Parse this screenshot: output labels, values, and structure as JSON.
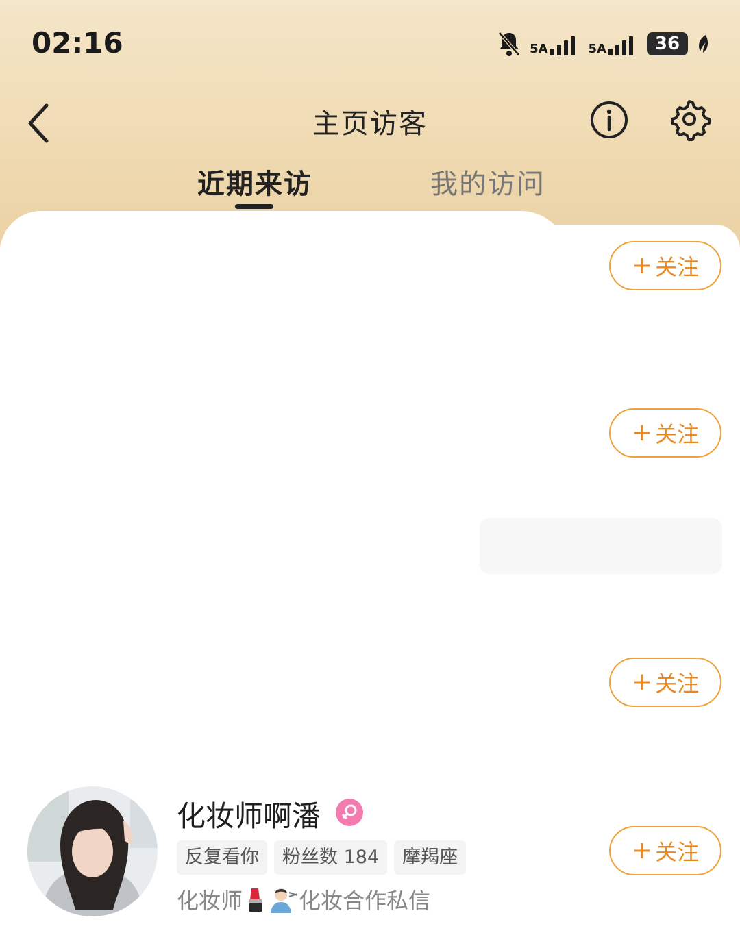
{
  "status_bar": {
    "time": "02:16",
    "signal1_label": "5A",
    "signal2_label": "5A",
    "battery": "36"
  },
  "nav": {
    "title": "主页访客"
  },
  "tabs": [
    {
      "label": "近期来访",
      "active": true
    },
    {
      "label": "我的访问",
      "active": false
    }
  ],
  "visitors": [
    {
      "follow_label": "关注"
    },
    {
      "follow_label": "关注"
    },
    {
      "follow_label": "关注"
    },
    {
      "name": "化妆师啊潘",
      "gender": "female",
      "tags": [
        "反复看你",
        "粉丝数 184",
        "摩羯座"
      ],
      "bio_prefix": "化妆师",
      "bio_suffix": "化妆合作私信",
      "follow_label": "关注"
    }
  ],
  "colors": {
    "header_gradient_top": "#f4e6c9",
    "header_gradient_bottom": "#e9cf9f",
    "accent": "#ea8a1e",
    "gender_badge": "#f37bb0"
  }
}
